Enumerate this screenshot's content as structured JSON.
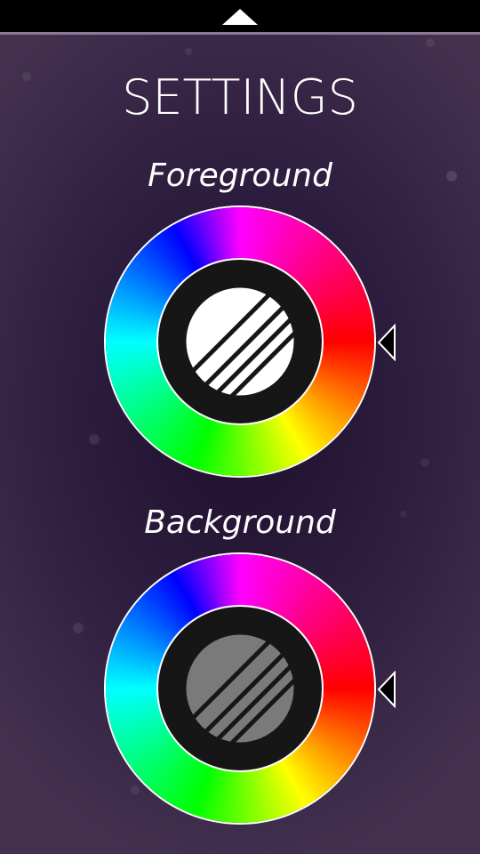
{
  "header": {
    "collapse_icon": "chevron-up-icon"
  },
  "page": {
    "title": "SETTINGS"
  },
  "foreground": {
    "label": "Foreground",
    "selected_color": "#ffffff",
    "picker_icon": "color-wheel-icon"
  },
  "background": {
    "label": "Background",
    "selected_color": "#7a7a7a",
    "picker_icon": "color-wheel-icon"
  },
  "theme": {
    "top_bar": "#000000",
    "accent_line": "#8a7a96",
    "bg_center": "#1e0f2e",
    "bg_edge": "#443150",
    "text": "#ffffff"
  }
}
